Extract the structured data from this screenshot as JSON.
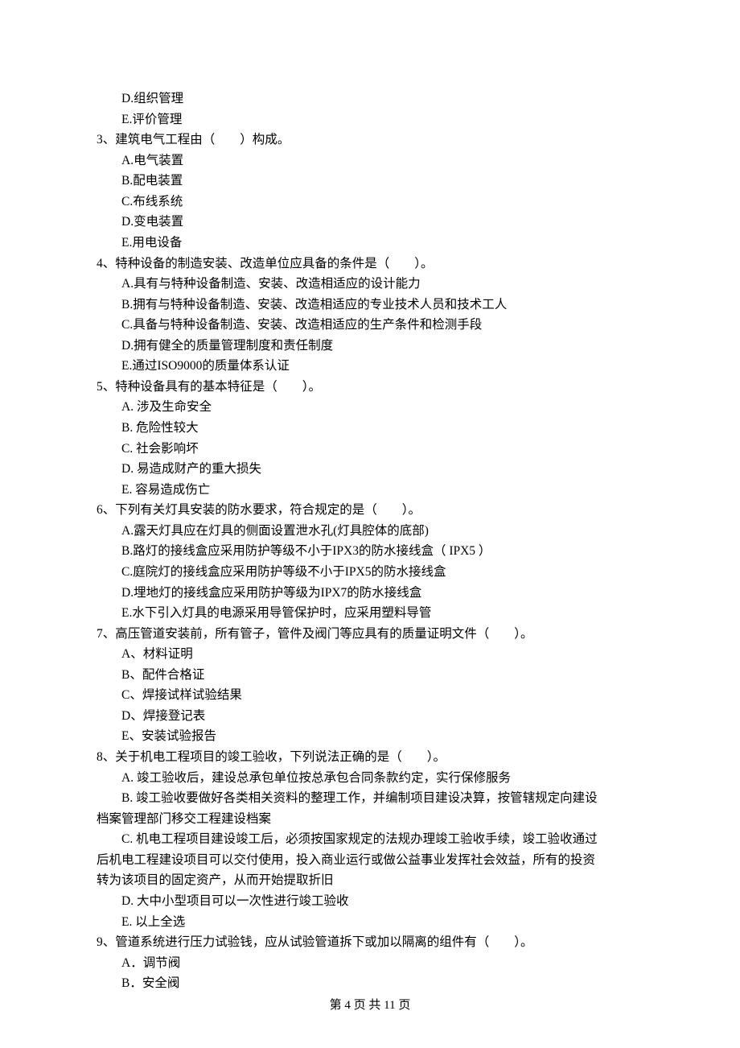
{
  "prelude": {
    "d": "D.组织管理",
    "e": "E.评价管理"
  },
  "q3": {
    "stem": "3、建筑电气工程由（　　）构成。",
    "a": "A.电气装置",
    "b": "B.配电装置",
    "c": "C.布线系统",
    "d": "D.变电装置",
    "e": "E.用电设备"
  },
  "q4": {
    "stem": "4、特种设备的制造安装、改造单位应具备的条件是（　　）。",
    "a": "A.具有与特种设备制造、安装、改造相适应的设计能力",
    "b": "B.拥有与特种设备制造、安装、改造相适应的专业技术人员和技术工人",
    "c": "C.具备与特种设备制造、安装、改造相适应的生产条件和检测手段",
    "d": "D.拥有健全的质量管理制度和责任制度",
    "e": "E.通过ISO9000的质量体系认证"
  },
  "q5": {
    "stem": "5、特种设备具有的基本特征是（　　）。",
    "a": "A. 涉及生命安全",
    "b": "B. 危险性较大",
    "c": "C. 社会影响坏",
    "d": "D. 易造成财产的重大损失",
    "e": "E. 容易造成伤亡"
  },
  "q6": {
    "stem": "6、下列有关灯具安装的防水要求，符合规定的是（　　）。",
    "a": "A.露天灯具应在灯具的侧面设置泄水孔(灯具腔体的底部)",
    "b": "B.路灯的接线盒应采用防护等级不小于IPX3的防水接线盒（ IPX5 ）",
    "c": "C.庭院灯的接线盒应采用防护等级不小于IPX5的防水接线盒",
    "d": "D.埋地灯的接线盒应采用防护等级为IPX7的防水接线盒",
    "e": "E.水下引入灯具的电源采用导管保护时，应采用塑料导管"
  },
  "q7": {
    "stem": "7、高压管道安装前，所有管子，管件及阀门等应具有的质量证明文件（　　）。",
    "a": "A、材料证明",
    "b": "B、配件合格证",
    "c": "C、焊接试样试验结果",
    "d": "D、焊接登记表",
    "e": "E、安装试验报告"
  },
  "q8": {
    "stem": "8、关于机电工程项目的竣工验收，下列说法正确的是（　　）。",
    "a": "A. 竣工验收后，建设总承包单位按总承包合同条款约定，实行保修服务",
    "b1": "B. 竣工验收要做好各类相关资料的整理工作，并编制项目建设决算，按管辖规定向建设",
    "b2": "档案管理部门移交工程建设档案",
    "c1": "C. 机电工程项目建设竣工后，必须按国家规定的法规办理竣工验收手续，竣工验收通过",
    "c2": "后机电工程建设项目可以交付使用，投入商业运行或做公益事业发挥社会效益，所有的投资",
    "c3": "转为该项目的固定资产，从而开始提取折旧",
    "d": "D. 大中小型项目可以一次性进行竣工验收",
    "e": "E. 以上全选"
  },
  "q9": {
    "stem": "9、管道系统进行压力试验钱，应从试验管道拆下或加以隔离的组件有（　　）。",
    "a": "A．调节阀",
    "b": "B．安全阀"
  },
  "footer": "第 4 页 共 11 页"
}
